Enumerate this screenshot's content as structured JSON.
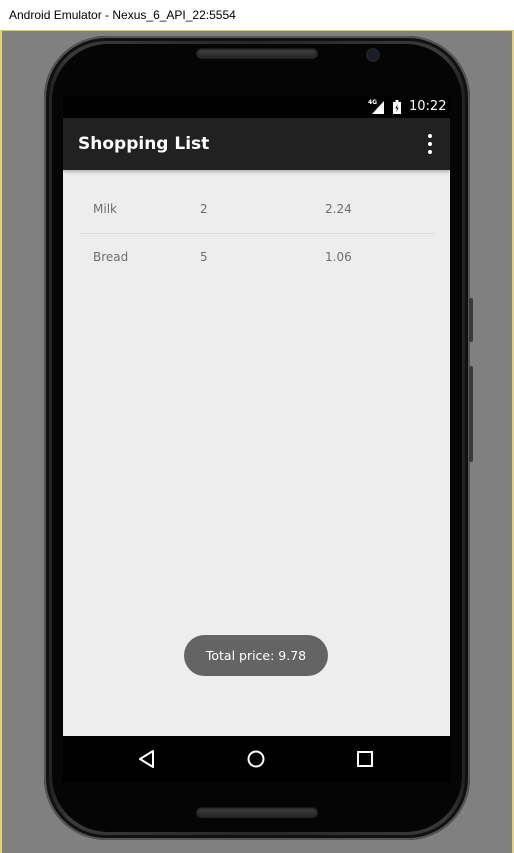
{
  "window": {
    "title": "Android Emulator - Nexus_6_API_22:5554"
  },
  "status_bar": {
    "network": "4G",
    "time": "10:22",
    "icons": [
      "signal-icon",
      "battery-icon"
    ]
  },
  "app_bar": {
    "title": "Shopping List",
    "overflow_icon": "more-vert-icon"
  },
  "items": [
    {
      "name": "Milk",
      "quantity": "2",
      "price": "2.24"
    },
    {
      "name": "Bread",
      "quantity": "5",
      "price": "1.06"
    }
  ],
  "toast": {
    "text": "Total price: 9.78"
  },
  "nav_bar": {
    "icons": [
      "back-icon",
      "home-icon",
      "recents-icon"
    ]
  },
  "colors": {
    "app_bar": "#212121",
    "screen_background": "#ededed",
    "toast_background": "#646464",
    "list_text": "#6e6e6e"
  }
}
